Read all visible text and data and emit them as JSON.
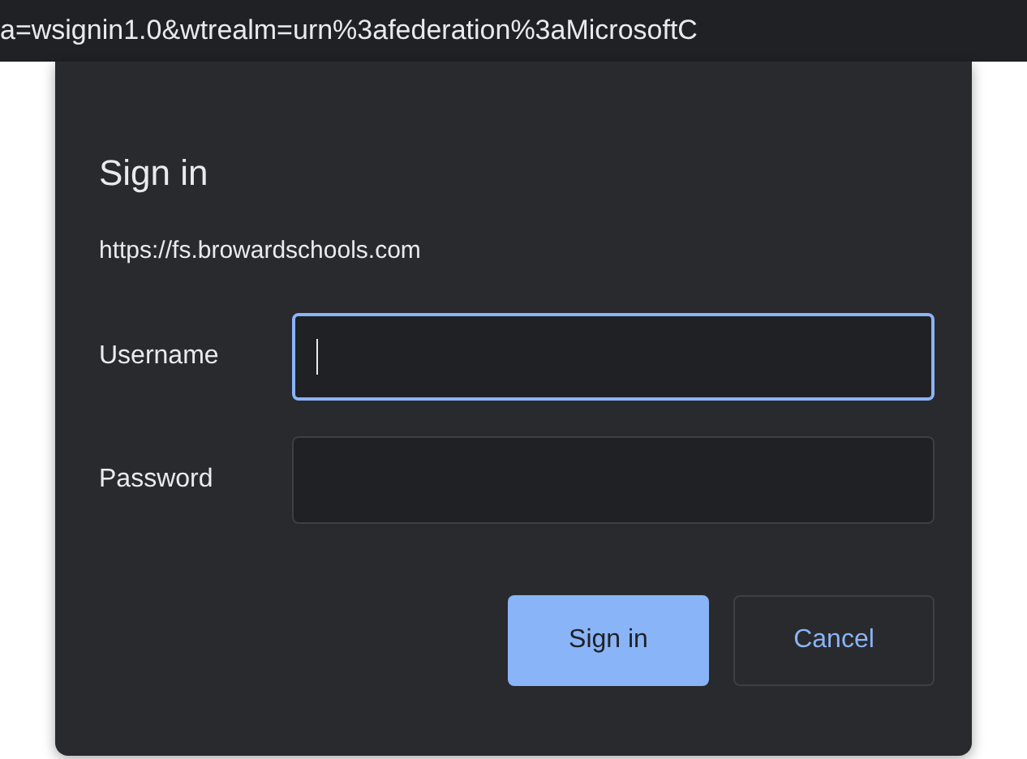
{
  "address_bar": {
    "url": "a=wsignin1.0&wtrealm=urn%3afederation%3aMicrosoftC"
  },
  "dialog": {
    "title": "Sign in",
    "origin": "https://fs.browardschools.com",
    "fields": [
      {
        "label": "Username",
        "focused": true
      },
      {
        "label": "Password",
        "focused": false
      }
    ],
    "buttons": [
      {
        "label": "Sign in",
        "kind": "primary"
      },
      {
        "label": "Cancel",
        "kind": "secondary"
      }
    ]
  }
}
